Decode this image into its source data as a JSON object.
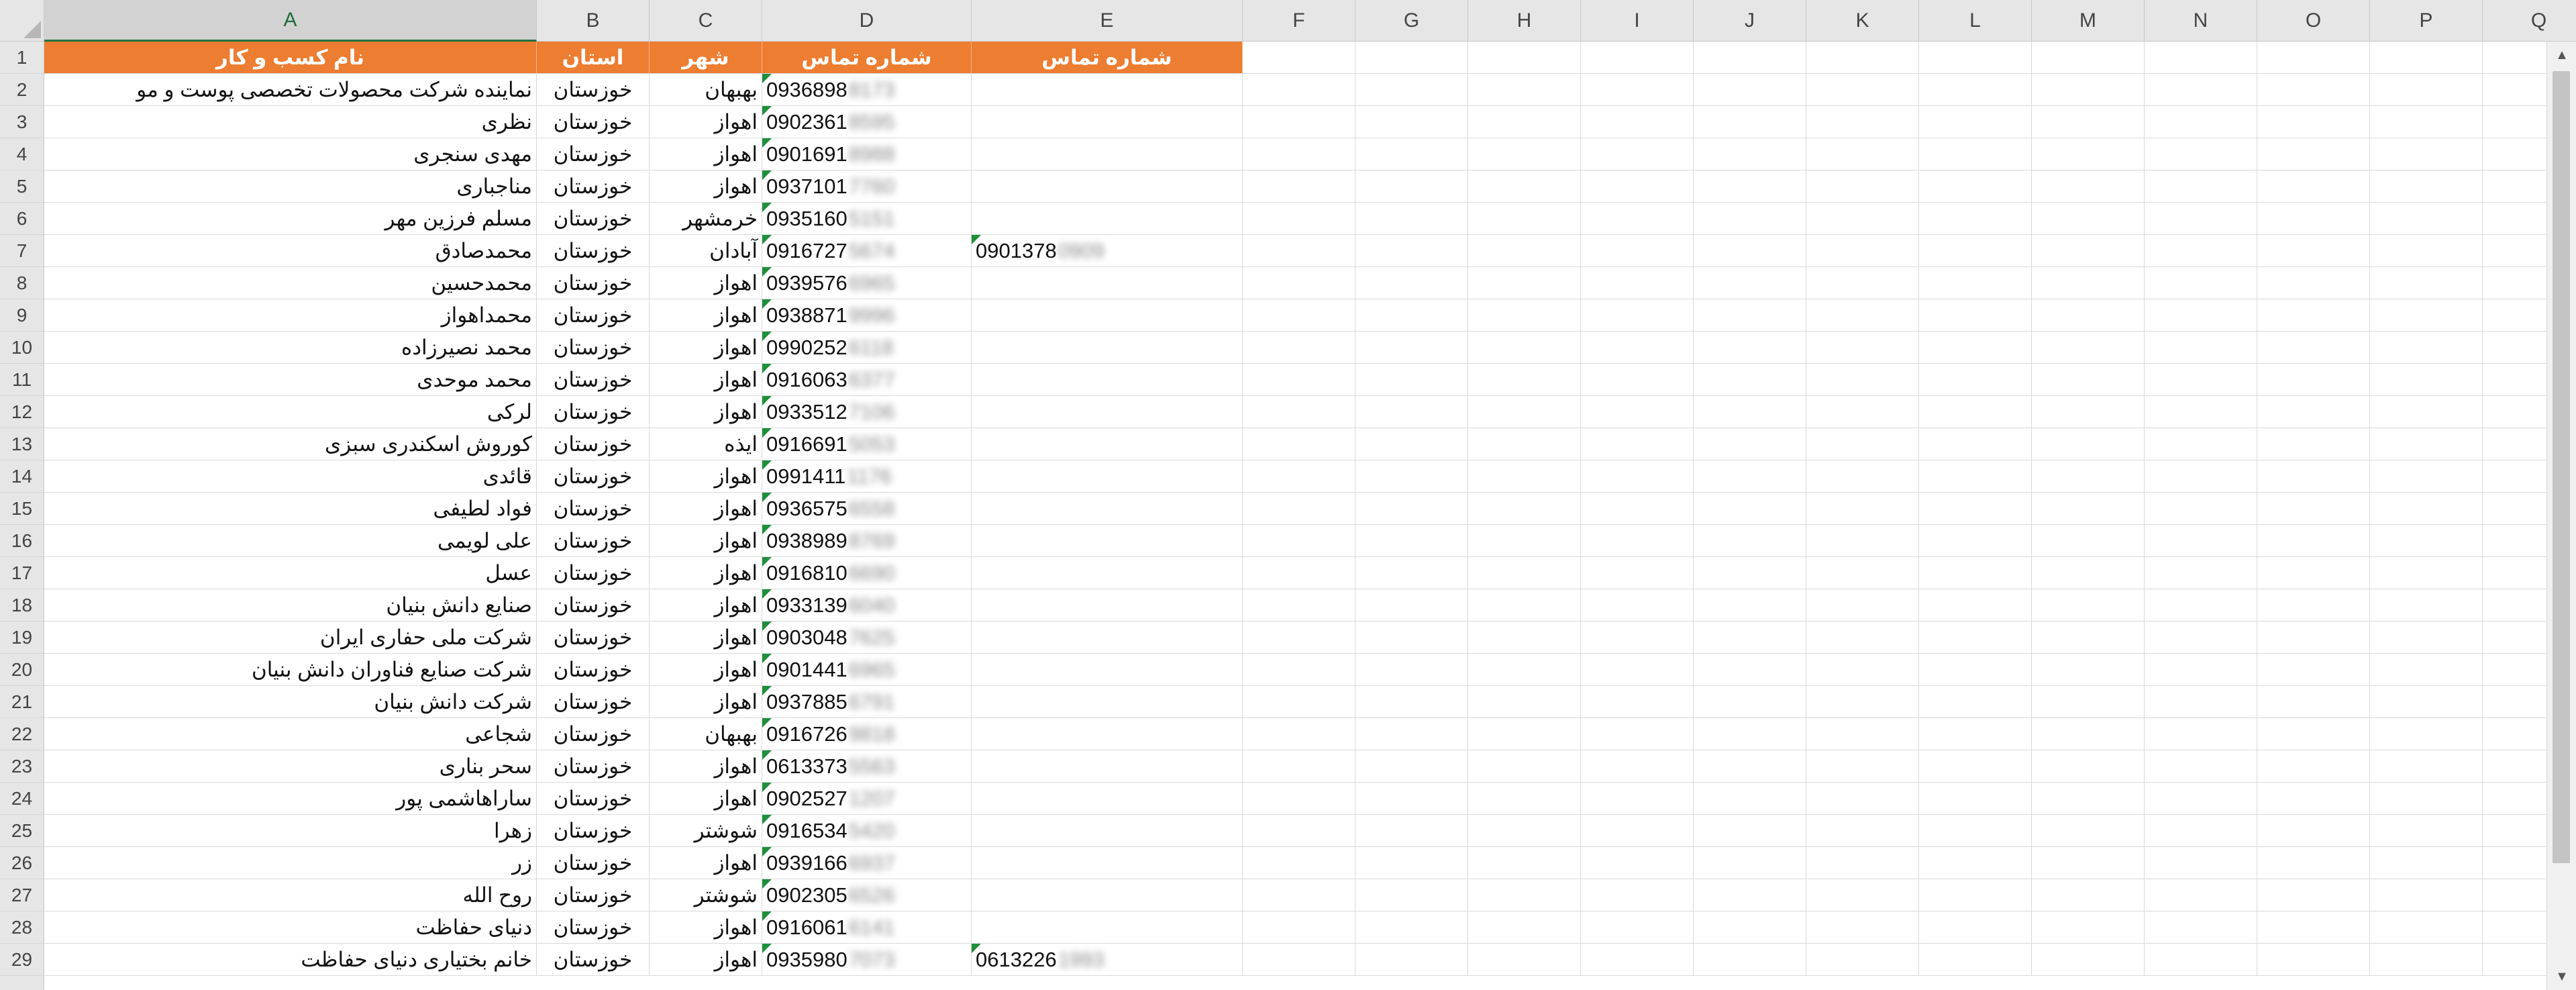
{
  "columns": [
    "A",
    "B",
    "C",
    "D",
    "E",
    "F",
    "G",
    "H",
    "I",
    "J",
    "K",
    "L",
    "M",
    "N",
    "O",
    "P",
    "Q"
  ],
  "selected_column": "A",
  "header_row": {
    "A": "نام کسب و کار",
    "B": "استان",
    "C": "شهر",
    "D": "شماره تماس",
    "E": "شماره تماس"
  },
  "rows": [
    {
      "n": "2",
      "a": "نماینده شرکت محصولات تخصصی پوست و مو",
      "b": "خوزستان",
      "c": "بهبهان",
      "d": "0936898",
      "dh": "8173",
      "e": "",
      "eh": ""
    },
    {
      "n": "3",
      "a": "نظری",
      "b": "خوزستان",
      "c": "اهواز",
      "d": "0902361",
      "dh": "8595",
      "e": "",
      "eh": ""
    },
    {
      "n": "4",
      "a": "مهدی سنجری",
      "b": "خوزستان",
      "c": "اهواز",
      "d": "0901691",
      "dh": "8988",
      "e": "",
      "eh": ""
    },
    {
      "n": "5",
      "a": "مناجباری",
      "b": "خوزستان",
      "c": "اهواز",
      "d": "0937101",
      "dh": "7760",
      "e": "",
      "eh": ""
    },
    {
      "n": "6",
      "a": "مسلم فرزین مهر",
      "b": "خوزستان",
      "c": "خرمشهر",
      "d": "0935160",
      "dh": "5151",
      "e": "",
      "eh": ""
    },
    {
      "n": "7",
      "a": "محمدصادق",
      "b": "خوزستان",
      "c": "آبادان",
      "d": "0916727",
      "dh": "5674",
      "e": "0901378",
      "eh": "0909"
    },
    {
      "n": "8",
      "a": "محمدحسین",
      "b": "خوزستان",
      "c": "اهواز",
      "d": "0939576",
      "dh": "6965",
      "e": "",
      "eh": ""
    },
    {
      "n": "9",
      "a": "محمداهواز",
      "b": "خوزستان",
      "c": "اهواز",
      "d": "0938871",
      "dh": "9996",
      "e": "",
      "eh": ""
    },
    {
      "n": "10",
      "a": "محمد نصیرزاده",
      "b": "خوزستان",
      "c": "اهواز",
      "d": "0990252",
      "dh": "6118",
      "e": "",
      "eh": ""
    },
    {
      "n": "11",
      "a": "محمد موحدی",
      "b": "خوزستان",
      "c": "اهواز",
      "d": "0916063",
      "dh": "6377",
      "e": "",
      "eh": ""
    },
    {
      "n": "12",
      "a": "لرکی",
      "b": "خوزستان",
      "c": "اهواز",
      "d": "0933512",
      "dh": "7106",
      "e": "",
      "eh": ""
    },
    {
      "n": "13",
      "a": "کوروش اسکندری سبزی",
      "b": "خوزستان",
      "c": "ایذه",
      "d": "0916691",
      "dh": "5053",
      "e": "",
      "eh": ""
    },
    {
      "n": "14",
      "a": "قائدی",
      "b": "خوزستان",
      "c": "اهواز",
      "d": "0991411",
      "dh": "1176",
      "e": "",
      "eh": ""
    },
    {
      "n": "15",
      "a": "فواد لطیفی",
      "b": "خوزستان",
      "c": "اهواز",
      "d": "0936575",
      "dh": "6558",
      "e": "",
      "eh": ""
    },
    {
      "n": "16",
      "a": "علی لویمی",
      "b": "خوزستان",
      "c": "اهواز",
      "d": "0938989",
      "dh": "8769",
      "e": "",
      "eh": ""
    },
    {
      "n": "17",
      "a": "عسل",
      "b": "خوزستان",
      "c": "اهواز",
      "d": "0916810",
      "dh": "6690",
      "e": "",
      "eh": ""
    },
    {
      "n": "18",
      "a": "صنایع دانش بنیان",
      "b": "خوزستان",
      "c": "اهواز",
      "d": "0933139",
      "dh": "6040",
      "e": "",
      "eh": ""
    },
    {
      "n": "19",
      "a": "شرکت ملی حفاری ایران",
      "b": "خوزستان",
      "c": "اهواز",
      "d": "0903048",
      "dh": "7625",
      "e": "",
      "eh": ""
    },
    {
      "n": "20",
      "a": "شرکت صنایع فناوران دانش بنیان",
      "b": "خوزستان",
      "c": "اهواز",
      "d": "0901441",
      "dh": "6965",
      "e": "",
      "eh": ""
    },
    {
      "n": "21",
      "a": "شرکت دانش بنیان",
      "b": "خوزستان",
      "c": "اهواز",
      "d": "0937885",
      "dh": "6791",
      "e": "",
      "eh": ""
    },
    {
      "n": "22",
      "a": "شجاعی",
      "b": "خوزستان",
      "c": "بهبهان",
      "d": "0916726",
      "dh": "9818",
      "e": "",
      "eh": ""
    },
    {
      "n": "23",
      "a": "سحر بناری",
      "b": "خوزستان",
      "c": "اهواز",
      "d": "0613373",
      "dh": "5563",
      "e": "",
      "eh": ""
    },
    {
      "n": "24",
      "a": "ساراهاشمی پور",
      "b": "خوزستان",
      "c": "اهواز",
      "d": "0902527",
      "dh": "1207",
      "e": "",
      "eh": ""
    },
    {
      "n": "25",
      "a": "زهرا",
      "b": "خوزستان",
      "c": "شوشتر",
      "d": "0916534",
      "dh": "5420",
      "e": "",
      "eh": ""
    },
    {
      "n": "26",
      "a": "زر",
      "b": "خوزستان",
      "c": "اهواز",
      "d": "0939166",
      "dh": "6937",
      "e": "",
      "eh": ""
    },
    {
      "n": "27",
      "a": "روح الله",
      "b": "خوزستان",
      "c": "شوشتر",
      "d": "0902305",
      "dh": "6526",
      "e": "",
      "eh": ""
    },
    {
      "n": "28",
      "a": "دنیای حفاظت",
      "b": "خوزستان",
      "c": "اهواز",
      "d": "0916061",
      "dh": "6141",
      "e": "",
      "eh": ""
    },
    {
      "n": "29",
      "a": "خانم بختیاری دنیای حفاظت",
      "b": "خوزستان",
      "c": "اهواز",
      "d": "0935980",
      "dh": "7073",
      "e": "0613226",
      "eh": "1993"
    }
  ],
  "colors": {
    "header_fill": "#ed7d31",
    "header_text": "#ffffff",
    "grid": "#dadada",
    "comment_flag": "#1e8f3a"
  },
  "icons": {
    "select_all": "select-all-triangle-icon",
    "scroll_up": "chevron-up-icon",
    "scroll_down": "chevron-down-icon"
  }
}
